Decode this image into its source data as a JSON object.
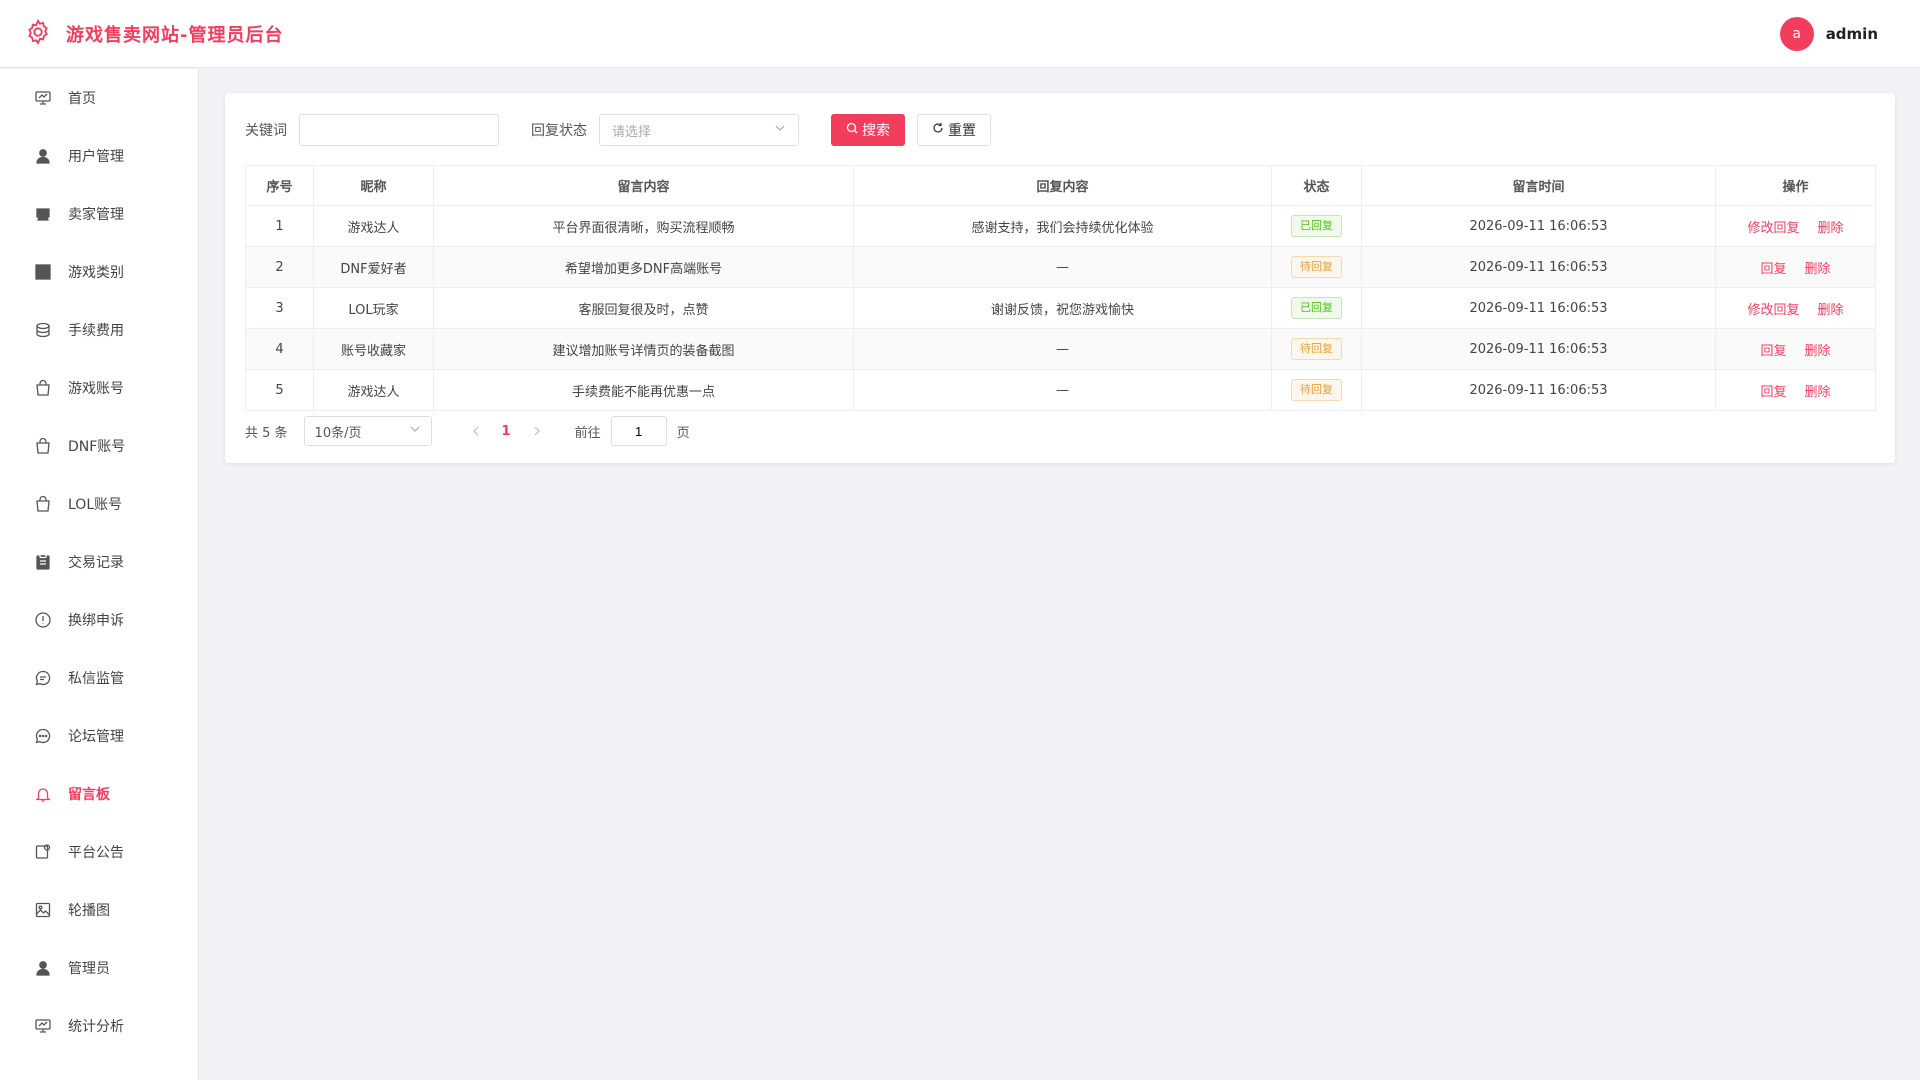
{
  "header": {
    "title": "游戏售卖网站-管理员后台",
    "avatar_letter": "a",
    "username": "admin",
    "brand_color": "#f23d5c"
  },
  "sidebar": {
    "items": [
      {
        "label": "首页",
        "icon": "dashboard-icon"
      },
      {
        "label": "用户管理",
        "icon": "user-icon"
      },
      {
        "label": "卖家管理",
        "icon": "seller-icon"
      },
      {
        "label": "游戏类别",
        "icon": "grid-icon"
      },
      {
        "label": "手续费用",
        "icon": "coins-icon"
      },
      {
        "label": "游戏账号",
        "icon": "bag-icon"
      },
      {
        "label": "DNF账号",
        "icon": "bag-icon"
      },
      {
        "label": "LOL账号",
        "icon": "bag-icon"
      },
      {
        "label": "交易记录",
        "icon": "clipboard-icon"
      },
      {
        "label": "换绑申诉",
        "icon": "warning-icon"
      },
      {
        "label": "私信监管",
        "icon": "chat-icon"
      },
      {
        "label": "论坛管理",
        "icon": "forum-icon"
      },
      {
        "label": "留言板",
        "icon": "bell-icon",
        "active": true
      },
      {
        "label": "平台公告",
        "icon": "notice-icon"
      },
      {
        "label": "轮播图",
        "icon": "picture-icon"
      },
      {
        "label": "管理员",
        "icon": "admin-icon"
      },
      {
        "label": "统计分析",
        "icon": "chart-icon"
      }
    ]
  },
  "search": {
    "keyword_label": "关键词",
    "keyword_value": "",
    "status_label": "回复状态",
    "status_placeholder": "请选择",
    "search_label": "搜索",
    "reset_label": "重置"
  },
  "table": {
    "columns": [
      "序号",
      "昵称",
      "留言内容",
      "回复内容",
      "状态",
      "留言时间",
      "操作"
    ],
    "rows": [
      {
        "id": "1",
        "nickname": "游戏达人",
        "content": "平台界面很清晰，购买流程顺畅",
        "reply": "感谢支持，我们会持续优化体验",
        "status": "已回复",
        "replied": true,
        "time": "2026-09-11 16:06:53",
        "action": "修改回复",
        "delete": "删除"
      },
      {
        "id": "2",
        "nickname": "DNF爱好者",
        "content": "希望增加更多DNF高端账号",
        "reply": "—",
        "status": "待回复",
        "replied": false,
        "time": "2026-09-11 16:06:53",
        "action": "回复",
        "delete": "删除"
      },
      {
        "id": "3",
        "nickname": "LOL玩家",
        "content": "客服回复很及时，点赞",
        "reply": "谢谢反馈，祝您游戏愉快",
        "status": "已回复",
        "replied": true,
        "time": "2026-09-11 16:06:53",
        "action": "修改回复",
        "delete": "删除"
      },
      {
        "id": "4",
        "nickname": "账号收藏家",
        "content": "建议增加账号详情页的装备截图",
        "reply": "—",
        "status": "待回复",
        "replied": false,
        "time": "2026-09-11 16:06:53",
        "action": "回复",
        "delete": "删除"
      },
      {
        "id": "5",
        "nickname": "游戏达人",
        "content": "手续费能不能再优惠一点",
        "reply": "—",
        "status": "待回复",
        "replied": false,
        "time": "2026-09-11 16:06:53",
        "action": "回复",
        "delete": "删除"
      }
    ]
  },
  "pagination": {
    "total_text": "共 5 条",
    "page_size": "10条/页",
    "current_page": "1",
    "goto_label": "前往",
    "goto_value": "1",
    "page_suffix": "页"
  }
}
